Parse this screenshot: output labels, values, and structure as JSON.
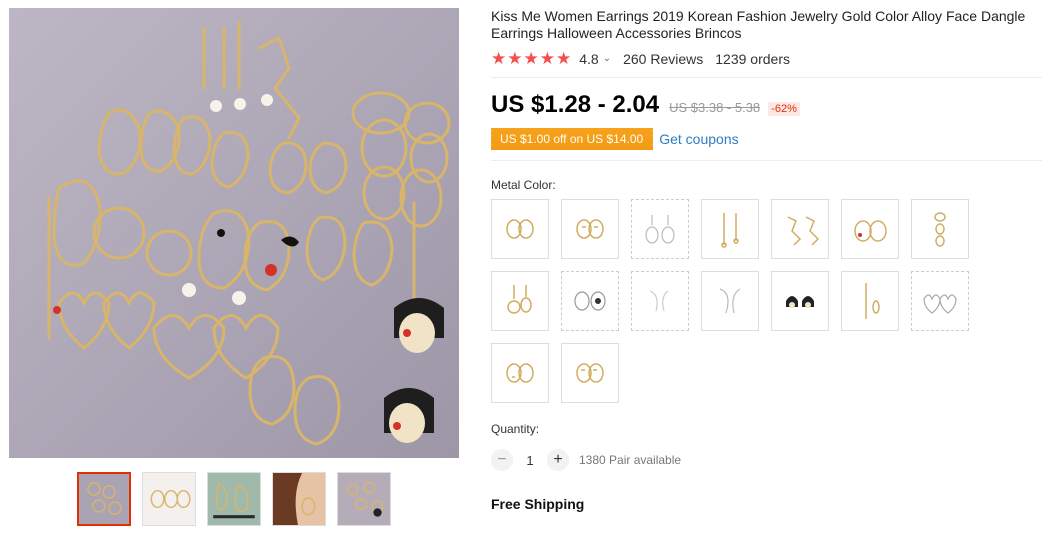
{
  "product": {
    "title": "Kiss Me Women Earrings 2019 Korean Fashion Jewelry Gold Color Alloy Face Dangle Earrings Halloween Accessories Brincos",
    "rating": "4.8",
    "rating_caret": "⌄",
    "reviews": "260 Reviews",
    "orders": "1239 orders",
    "stars": 5
  },
  "price": {
    "current": "US $1.28 - 2.04",
    "original": "US $3.38 - 5.38",
    "discount": "-62%"
  },
  "coupon": {
    "label": "US $1.00 off on US $14.00",
    "link": "Get coupons"
  },
  "sku": {
    "label": "Metal Color:",
    "options_count": 16
  },
  "quantity": {
    "label": "Quantity:",
    "value": "1",
    "minus": "−",
    "plus": "+",
    "available": "1380 Pair available"
  },
  "shipping": {
    "label": "Free Shipping"
  },
  "gallery": {
    "thumbnails": 5,
    "active_index": 0
  },
  "colors": {
    "accent": "#e62e04",
    "star": "#f74d4d",
    "coupon": "#f49a14",
    "link": "#2e7dc4",
    "gold": "#c9a24e"
  }
}
